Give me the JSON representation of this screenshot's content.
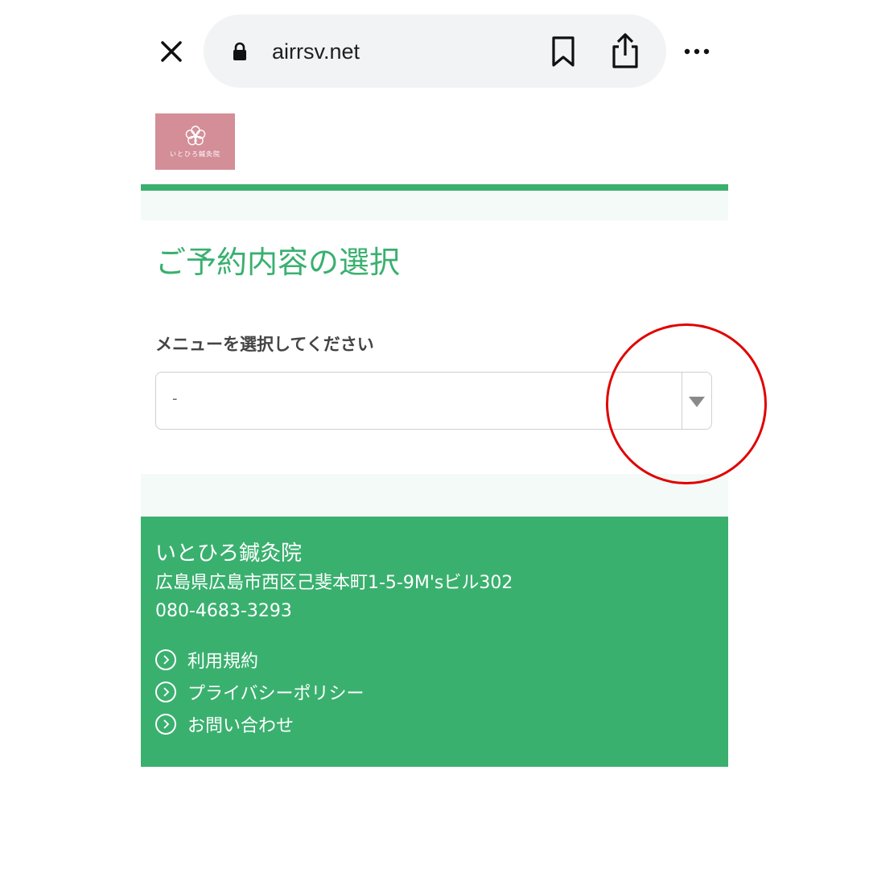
{
  "browser": {
    "url": "airrsv.net",
    "icons": [
      "close-icon",
      "lock-icon",
      "bookmark-icon",
      "share-icon",
      "more-icon"
    ]
  },
  "header": {
    "logo_text": "いとひろ鍼灸院",
    "logo_color": "#d38e98"
  },
  "main": {
    "title": "ご予約内容の選択",
    "menu_label": "メニューを選択してください",
    "menu_select": {
      "value": "-"
    }
  },
  "footer": {
    "name": "いとひろ鍼灸院",
    "address": "広島県広島市西区己斐本町1-5-9M'sビル302",
    "phone": "080-4683-3293",
    "links": [
      {
        "label": "利用規約"
      },
      {
        "label": "プライバシーポリシー"
      },
      {
        "label": "お問い合わせ"
      }
    ]
  },
  "colors": {
    "accent": "#3ab06f",
    "highlight": "#e00000"
  }
}
